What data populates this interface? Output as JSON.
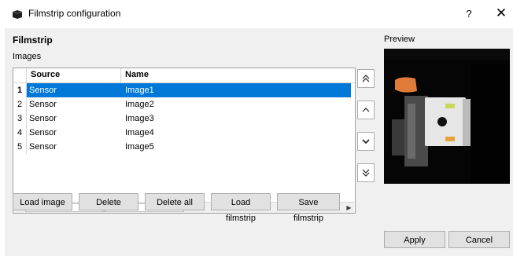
{
  "window": {
    "title": "Filmstrip configuration",
    "help_label": "?",
    "close_label": "✕"
  },
  "section": {
    "title": "Filmstrip",
    "images_label": "Images",
    "preview_label": "Preview"
  },
  "table": {
    "columns": [
      "Source",
      "Name"
    ],
    "rows": [
      {
        "index": "1",
        "source": "Sensor",
        "name": "Image1",
        "selected": true
      },
      {
        "index": "2",
        "source": "Sensor",
        "name": "Image2",
        "selected": false
      },
      {
        "index": "3",
        "source": "Sensor",
        "name": "Image3",
        "selected": false
      },
      {
        "index": "4",
        "source": "Sensor",
        "name": "Image4",
        "selected": false
      },
      {
        "index": "5",
        "source": "Sensor",
        "name": "Image5",
        "selected": false
      }
    ]
  },
  "buttons": {
    "load_image": "Load image",
    "delete": "Delete",
    "delete_all": "Delete all",
    "load_filmstrip": "Load filmstrip",
    "save_filmstrip": "Save filmstrip",
    "apply": "Apply",
    "cancel": "Cancel"
  },
  "side_buttons": {
    "move_top": "double-chevron-up-icon",
    "move_up": "chevron-up-icon",
    "move_down": "chevron-down-icon",
    "move_bottom": "double-chevron-down-icon"
  },
  "colors": {
    "selection": "#0078d7",
    "dialog_bg": "#f0f0f0"
  }
}
